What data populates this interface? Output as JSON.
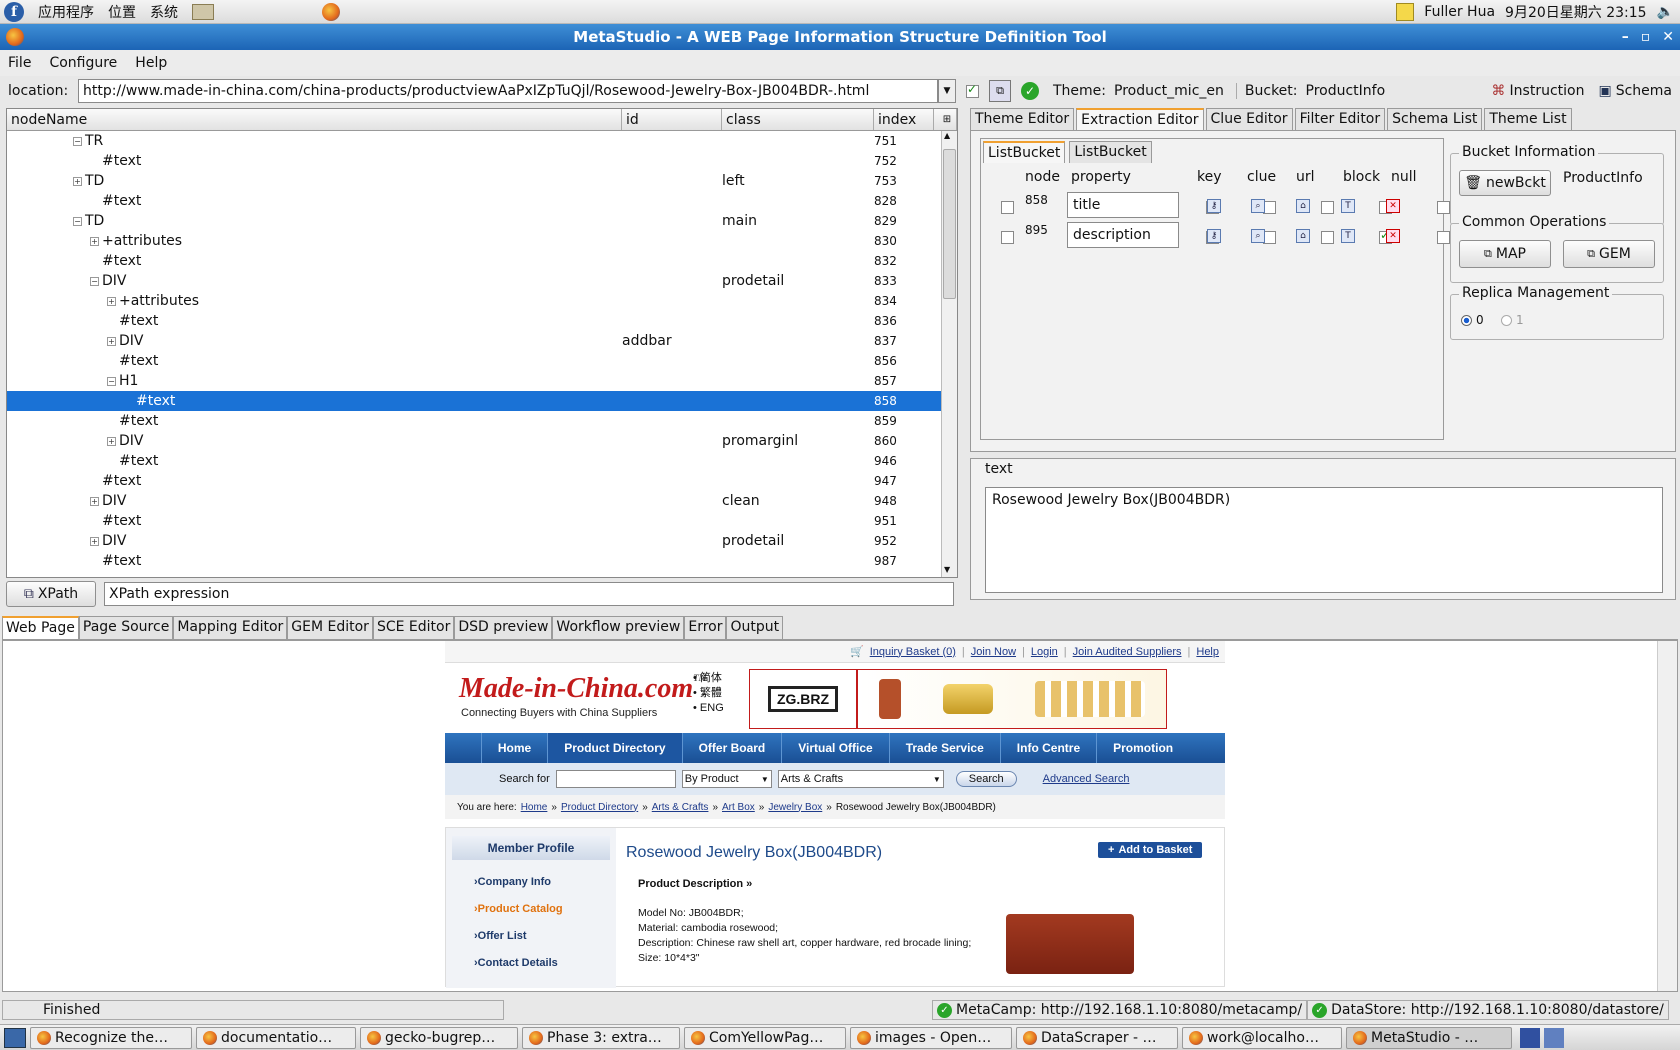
{
  "top_panel": {
    "apps": "应用程序",
    "places": "位置",
    "system": "系统",
    "user": "Fuller Hua",
    "clock": "9月20日星期六 23:15"
  },
  "window": {
    "title": "MetaStudio - A WEB Page Information Structure Definition Tool"
  },
  "menubar": {
    "file": "File",
    "configure": "Configure",
    "help": "Help"
  },
  "location": {
    "label": "location:",
    "url": "http://www.made-in-china.com/china-products/productviewAaPxIZpTuQjl/Rosewood-Jewelry-Box-JB004BDR-.html",
    "theme_label": "Theme:",
    "theme": "Product_mic_en",
    "bucket_label": "Bucket:",
    "bucket": "ProductInfo",
    "instruction": "Instruction",
    "schema": "Schema"
  },
  "tree": {
    "headers": {
      "nodeName": "nodeName",
      "id": "id",
      "class": "class",
      "index": "index"
    },
    "rows": [
      {
        "name": "TR",
        "id": "",
        "cls": "",
        "index": "751"
      },
      {
        "name": "#text",
        "id": "",
        "cls": "",
        "index": "752"
      },
      {
        "name": "TD",
        "id": "",
        "cls": "left",
        "index": "753"
      },
      {
        "name": "#text",
        "id": "",
        "cls": "",
        "index": "828"
      },
      {
        "name": "TD",
        "id": "",
        "cls": "main",
        "index": "829"
      },
      {
        "name": "+attributes",
        "id": "",
        "cls": "",
        "index": "830"
      },
      {
        "name": "#text",
        "id": "",
        "cls": "",
        "index": "832"
      },
      {
        "name": "DIV",
        "id": "",
        "cls": "prodetail",
        "index": "833"
      },
      {
        "name": "+attributes",
        "id": "",
        "cls": "",
        "index": "834"
      },
      {
        "name": "#text",
        "id": "",
        "cls": "",
        "index": "836"
      },
      {
        "name": "DIV",
        "id": "addbar",
        "cls": "",
        "index": "837"
      },
      {
        "name": "#text",
        "id": "",
        "cls": "",
        "index": "856"
      },
      {
        "name": "H1",
        "id": "",
        "cls": "",
        "index": "857"
      },
      {
        "name": "#text",
        "id": "",
        "cls": "",
        "index": "858"
      },
      {
        "name": "#text",
        "id": "",
        "cls": "",
        "index": "859"
      },
      {
        "name": "DIV",
        "id": "",
        "cls": "promarginl",
        "index": "860"
      },
      {
        "name": "#text",
        "id": "",
        "cls": "",
        "index": "946"
      },
      {
        "name": "#text",
        "id": "",
        "cls": "",
        "index": "947"
      },
      {
        "name": "DIV",
        "id": "",
        "cls": "clean",
        "index": "948"
      },
      {
        "name": "#text",
        "id": "",
        "cls": "",
        "index": "951"
      },
      {
        "name": "DIV",
        "id": "",
        "cls": "prodetail",
        "index": "952"
      },
      {
        "name": "#text",
        "id": "",
        "cls": "",
        "index": "987"
      }
    ]
  },
  "xpath": {
    "button": "XPath",
    "expression": "XPath expression"
  },
  "right_tabs": [
    "Theme Editor",
    "Extraction Editor",
    "Clue Editor",
    "Filter Editor",
    "Schema List",
    "Theme List"
  ],
  "listbucket": {
    "tabs": [
      "ListBucket",
      "ListBucket"
    ],
    "headers": {
      "node": "node",
      "property": "property",
      "key": "key",
      "clue": "clue",
      "url": "url",
      "block": "block",
      "null": "null"
    },
    "rows": [
      {
        "node": "858",
        "property": "title"
      },
      {
        "node": "895",
        "property": "description"
      }
    ]
  },
  "bucket_info": {
    "legend": "Bucket Information",
    "new_button": "newBckt",
    "name": "ProductInfo"
  },
  "common_ops": {
    "legend": "Common Operations",
    "map": "MAP",
    "gem": "GEM"
  },
  "replica": {
    "legend": "Replica Management",
    "opt0": "0",
    "opt1": "1"
  },
  "text_panel": {
    "legend": "text",
    "value": "Rosewood Jewelry Box(JB004BDR)"
  },
  "bottom_tabs": [
    "Web Page",
    "Page Source",
    "Mapping Editor",
    "GEM Editor",
    "SCE Editor",
    "DSD preview",
    "Workflow preview",
    "Error",
    "Output"
  ],
  "webpage": {
    "toplinks": [
      "Inquiry Basket (0)",
      "Join Now",
      "Login",
      "Join Audited Suppliers",
      "Help"
    ],
    "logo": "Made-in-China.com",
    "logo_tm": "TM",
    "tagline": "Connecting Buyers with China Suppliers",
    "langs": [
      "• 简体",
      "• 繁體",
      "• ENG"
    ],
    "banner": "ZG.BRZ",
    "nav": [
      "Home",
      "Product Directory",
      "Offer Board",
      "Virtual Office",
      "Trade Service",
      "Info Centre",
      "Promotion"
    ],
    "search": {
      "label": "Search for",
      "by": "By Product",
      "cat": "Arts & Crafts",
      "button": "Search",
      "advanced": "Advanced Search"
    },
    "breadcrumb": {
      "prefix": "You are here:",
      "items": [
        "Home",
        "Product Directory",
        "Arts & Crafts",
        "Art Box",
        "Jewelry Box"
      ],
      "current": "Rosewood Jewelry Box(JB004BDR)"
    },
    "member": {
      "title": "Member Profile",
      "items": [
        "Company Info",
        "Product Catalog",
        "Offer List",
        "Contact Details"
      ]
    },
    "product": {
      "title": "Rosewood  Jewelry Box(JB004BDR)",
      "basket": "Add to Basket",
      "desc_title": "Product Description »",
      "lines": [
        "Model No: JB004BDR;",
        "Material: cambodia rosewood;",
        "Description: Chinese raw shell art, copper hardware, red brocade lining;",
        "Size: 10*4*3\""
      ]
    }
  },
  "status": {
    "text": "Finished",
    "metacamp": "MetaCamp: http://192.168.1.10:8080/metacamp/",
    "datastore": "DataStore: http://192.168.1.10:8080/datastore/"
  },
  "taskbar": [
    "Recognize the…",
    "documentatio…",
    "gecko-bugrep…",
    "Phase 3: extra…",
    "ComYellowPag…",
    "images - Open…",
    "DataScraper - …",
    "work@localho…",
    "MetaStudio - …"
  ]
}
